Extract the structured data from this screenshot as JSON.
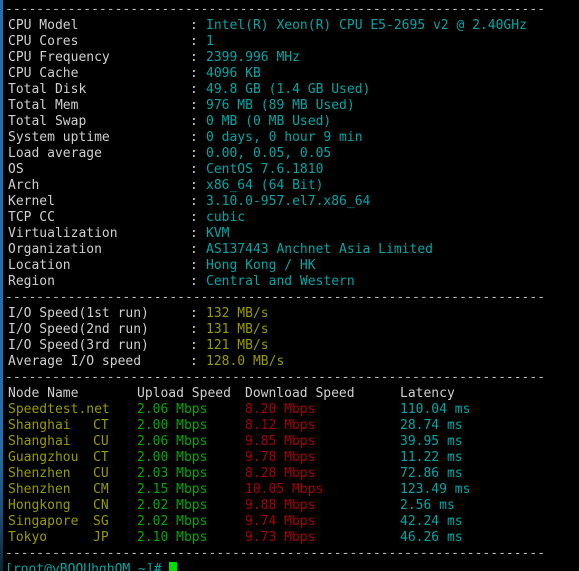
{
  "terminal": {
    "separator": "---------------------------------------------------------------------",
    "colon": ":",
    "prompt": "[root@vBOOUhghOM ~]#",
    "colors": {
      "background": "#000000",
      "label": "#cfcfcf",
      "value_cyan": "#00a6a6",
      "value_yellow": "#999900",
      "upload_green": "#00a800",
      "download_red": "#a80000",
      "latency_cyan": "#00a6a6",
      "cursor_green": "#00dd00",
      "stripe_blue": "#2a6ea8"
    }
  },
  "system_info": [
    {
      "label": "CPU Model",
      "value": "Intel(R) Xeon(R) CPU E5-2695 v2 @ 2.40GHz"
    },
    {
      "label": "CPU Cores",
      "value": "1"
    },
    {
      "label": "CPU Frequency",
      "value": "2399.996 MHz"
    },
    {
      "label": "CPU Cache",
      "value": "4096 KB"
    },
    {
      "label": "Total Disk",
      "value": "49.8 GB (1.4 GB Used)"
    },
    {
      "label": "Total Mem",
      "value": "976 MB (89 MB Used)"
    },
    {
      "label": "Total Swap",
      "value": "0 MB (0 MB Used)"
    },
    {
      "label": "System uptime",
      "value": "0 days, 0 hour 9 min"
    },
    {
      "label": "Load average",
      "value": "0.00, 0.05, 0.05"
    },
    {
      "label": "OS",
      "value": "CentOS 7.6.1810"
    },
    {
      "label": "Arch",
      "value": "x86_64 (64 Bit)"
    },
    {
      "label": "Kernel",
      "value": "3.10.0-957.el7.x86_64"
    },
    {
      "label": "TCP CC",
      "value": "cubic"
    },
    {
      "label": "Virtualization",
      "value": "KVM"
    },
    {
      "label": "Organization",
      "value": "AS137443 Anchnet Asia Limited"
    },
    {
      "label": "Location",
      "value": "Hong Kong / HK"
    },
    {
      "label": "Region",
      "value": "Central and Western"
    }
  ],
  "io_speed": [
    {
      "label": "I/O Speed(1st run)",
      "value": "132 MB/s"
    },
    {
      "label": "I/O Speed(2nd run)",
      "value": "131 MB/s"
    },
    {
      "label": "I/O Speed(3rd run)",
      "value": "121 MB/s"
    },
    {
      "label": "Average I/O speed",
      "value": "128.0 MB/s"
    }
  ],
  "speedtest": {
    "headers": {
      "node": "Node Name",
      "upload": "Upload Speed",
      "download": "Download Speed",
      "latency": "Latency"
    },
    "rows": [
      {
        "node": "Speedtest.net",
        "isp": "",
        "upload": "2.06 Mbps",
        "download": "8.20 Mbps",
        "latency": "110.04 ms"
      },
      {
        "node": "Shanghai",
        "isp": "CT",
        "upload": "2.00 Mbps",
        "download": "8.12 Mbps",
        "latency": "28.74 ms"
      },
      {
        "node": "Shanghai",
        "isp": "CU",
        "upload": "2.06 Mbps",
        "download": "9.85 Mbps",
        "latency": "39.95 ms"
      },
      {
        "node": "Guangzhou",
        "isp": "CT",
        "upload": "2.00 Mbps",
        "download": "9.78 Mbps",
        "latency": "11.22 ms"
      },
      {
        "node": "Shenzhen",
        "isp": "CU",
        "upload": "2.03 Mbps",
        "download": "8.28 Mbps",
        "latency": "72.86 ms"
      },
      {
        "node": "Shenzhen",
        "isp": "CM",
        "upload": "2.15 Mbps",
        "download": "10.05 Mbps",
        "latency": "123.49 ms"
      },
      {
        "node": "Hongkong",
        "isp": "CN",
        "upload": "2.02 Mbps",
        "download": "9.88 Mbps",
        "latency": "2.56 ms"
      },
      {
        "node": "Singapore",
        "isp": "SG",
        "upload": "2.02 Mbps",
        "download": "9.74 Mbps",
        "latency": "42.24 ms"
      },
      {
        "node": "Tokyo",
        "isp": "JP",
        "upload": "2.10 Mbps",
        "download": "9.73 Mbps",
        "latency": "46.26 ms"
      }
    ]
  }
}
